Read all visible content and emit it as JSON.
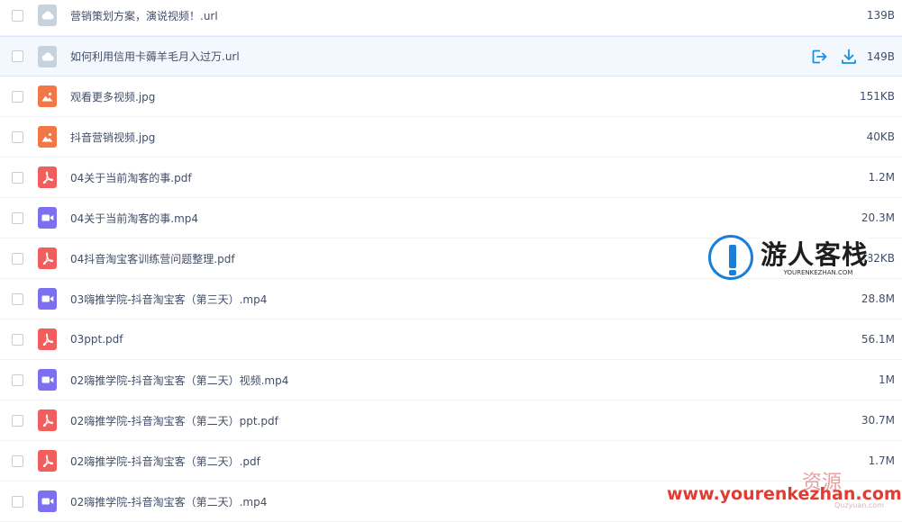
{
  "files": [
    {
      "name": "营销策划方案，演说视频！.url",
      "size": "139B",
      "type": "cloud",
      "icon": "cloud-file-icon"
    },
    {
      "name": "如何利用信用卡薅羊毛月入过万.url",
      "size": "149B",
      "type": "cloud",
      "icon": "cloud-file-icon",
      "hovered": true
    },
    {
      "name": "观看更多视频.jpg",
      "size": "151KB",
      "type": "image",
      "icon": "image-file-icon"
    },
    {
      "name": "抖音营销视频.jpg",
      "size": "40KB",
      "type": "image",
      "icon": "image-file-icon"
    },
    {
      "name": "04关于当前淘客的事.pdf",
      "size": "1.2M",
      "type": "pdf",
      "icon": "pdf-file-icon"
    },
    {
      "name": "04关于当前淘客的事.mp4",
      "size": "20.3M",
      "type": "video",
      "icon": "video-file-icon"
    },
    {
      "name": "04抖音淘宝客训练营问题整理.pdf",
      "size": "182KB",
      "type": "pdf",
      "icon": "pdf-file-icon"
    },
    {
      "name": "03嗨推学院-抖音淘宝客（第三天）.mp4",
      "size": "28.8M",
      "type": "video",
      "icon": "video-file-icon"
    },
    {
      "name": "03ppt.pdf",
      "size": "56.1M",
      "type": "pdf",
      "icon": "pdf-file-icon"
    },
    {
      "name": "02嗨推学院-抖音淘宝客（第二天）视频.mp4",
      "size": "1M",
      "type": "video",
      "icon": "video-file-icon"
    },
    {
      "name": "02嗨推学院-抖音淘宝客（第二天）ppt.pdf",
      "size": "30.7M",
      "type": "pdf",
      "icon": "pdf-file-icon"
    },
    {
      "name": "02嗨推学院-抖音淘宝客（第二天）.pdf",
      "size": "1.7M",
      "type": "pdf",
      "icon": "pdf-file-icon"
    },
    {
      "name": "02嗨推学院-抖音淘宝客（第二天）.mp4",
      "size": "",
      "type": "video",
      "icon": "video-file-icon"
    }
  ],
  "row_actions": {
    "share_icon": "share-icon",
    "download_icon": "download-icon"
  },
  "watermark": {
    "title": "游人客栈",
    "subtitle": "YOURENKEZHAN.COM",
    "url": "www.yourenkezhan.com",
    "corner_text": "资源",
    "corner_sub": "Quzyuan.com"
  },
  "colors": {
    "accent": "#1a8fe3",
    "text": "#424e67",
    "hover_bg": "#f3f8fe",
    "pdf": "#f25d5d",
    "video": "#7c6ff0",
    "image": "#f27747",
    "cloud": "#c7d2dc",
    "watermark_red": "#e23b32"
  }
}
